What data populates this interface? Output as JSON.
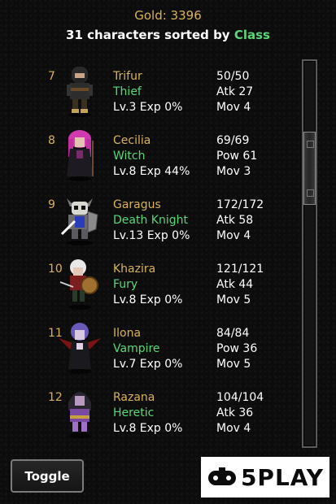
{
  "header": {
    "gold_text": "Gold: 3396",
    "sort_prefix": "31 characters sorted by ",
    "sort_key": "Class"
  },
  "characters": [
    {
      "index": "7",
      "name": "Trifur",
      "class": "Thief",
      "level_exp": "Lv.3  Exp 0%",
      "hp": "50/50",
      "stat": "Atk 27",
      "mov": "Mov 4",
      "sprite": "thief-sprite"
    },
    {
      "index": "8",
      "name": "Cecilia",
      "class": "Witch",
      "level_exp": "Lv.8  Exp 44%",
      "hp": "69/69",
      "stat": "Pow 61",
      "mov": "Mov 3",
      "sprite": "witch-sprite"
    },
    {
      "index": "9",
      "name": "Garagus",
      "class": "Death Knight",
      "level_exp": "Lv.13  Exp 0%",
      "hp": "172/172",
      "stat": "Atk 58",
      "mov": "Mov 4",
      "sprite": "death-knight-sprite"
    },
    {
      "index": "10",
      "name": "Khazira",
      "class": "Fury",
      "level_exp": "Lv.8  Exp 0%",
      "hp": "121/121",
      "stat": "Atk 44",
      "mov": "Mov 5",
      "sprite": "fury-sprite"
    },
    {
      "index": "11",
      "name": "Ilona",
      "class": "Vampire",
      "level_exp": "Lv.7  Exp 0%",
      "hp": "84/84",
      "stat": "Pow 36",
      "mov": "Mov 5",
      "sprite": "vampire-sprite"
    },
    {
      "index": "12",
      "name": "Razana",
      "class": "Heretic",
      "level_exp": "Lv.8  Exp 0%",
      "hp": "104/104",
      "stat": "Atk 36",
      "mov": "Mov 4",
      "sprite": "heretic-sprite"
    }
  ],
  "toggle_label": "Toggle",
  "logo_text": "5PLAY",
  "colors": {
    "gold": "#d8b25a",
    "class_green": "#59d77a",
    "background": "#0c0c0c"
  }
}
